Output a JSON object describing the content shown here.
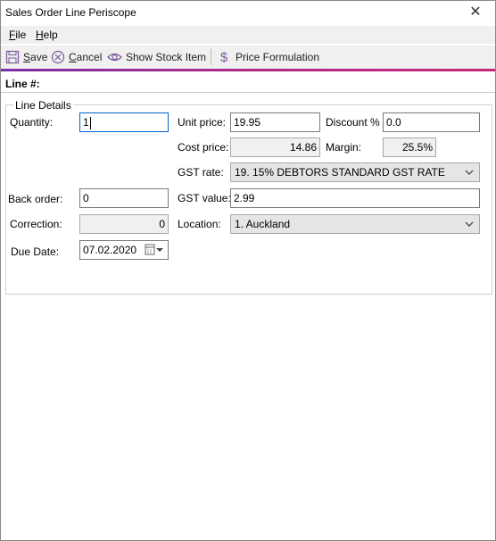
{
  "window": {
    "title": "Sales Order Line Periscope",
    "close_glyph": "✕"
  },
  "menu": {
    "file": {
      "accel": "F",
      "rest": "ile"
    },
    "help": {
      "accel": "H",
      "rest": "elp"
    }
  },
  "toolbar": {
    "save": {
      "accel": "S",
      "rest": "ave",
      "icon": "save-icon"
    },
    "cancel": {
      "accel": "C",
      "rest": "ancel",
      "icon": "cancel-icon"
    },
    "show_stock": {
      "label": "Show Stock Item",
      "icon": "eye-icon"
    },
    "price_formulation": {
      "label": "Price Formulation",
      "icon": "dollar-icon"
    }
  },
  "header": {
    "line_label": "Line #:"
  },
  "group": {
    "title": "Line Details"
  },
  "form": {
    "quantity": {
      "label": "Quantity:",
      "value": "1"
    },
    "unit_price": {
      "label": "Unit price:",
      "value": "19.95"
    },
    "discount": {
      "label": "Discount %",
      "value": "0.0"
    },
    "cost_price": {
      "label": "Cost price:",
      "value": "14.86"
    },
    "margin": {
      "label": "Margin:",
      "value": "25.5%"
    },
    "gst_rate": {
      "label": "GST rate:",
      "value": "19. 15% DEBTORS STANDARD GST RATE"
    },
    "back_order": {
      "label": "Back order:",
      "value": "0"
    },
    "gst_value": {
      "label": "GST value:",
      "value": "2.99"
    },
    "correction": {
      "label": "Correction:",
      "value": "0"
    },
    "location": {
      "label": "Location:",
      "value": "1. Auckland"
    },
    "due_date": {
      "label": "Due Date:",
      "value": "07.02.2020"
    }
  },
  "colors": {
    "accent_start": "#7a2fa8",
    "accent_end": "#c4287a",
    "focus": "#0064c8"
  }
}
